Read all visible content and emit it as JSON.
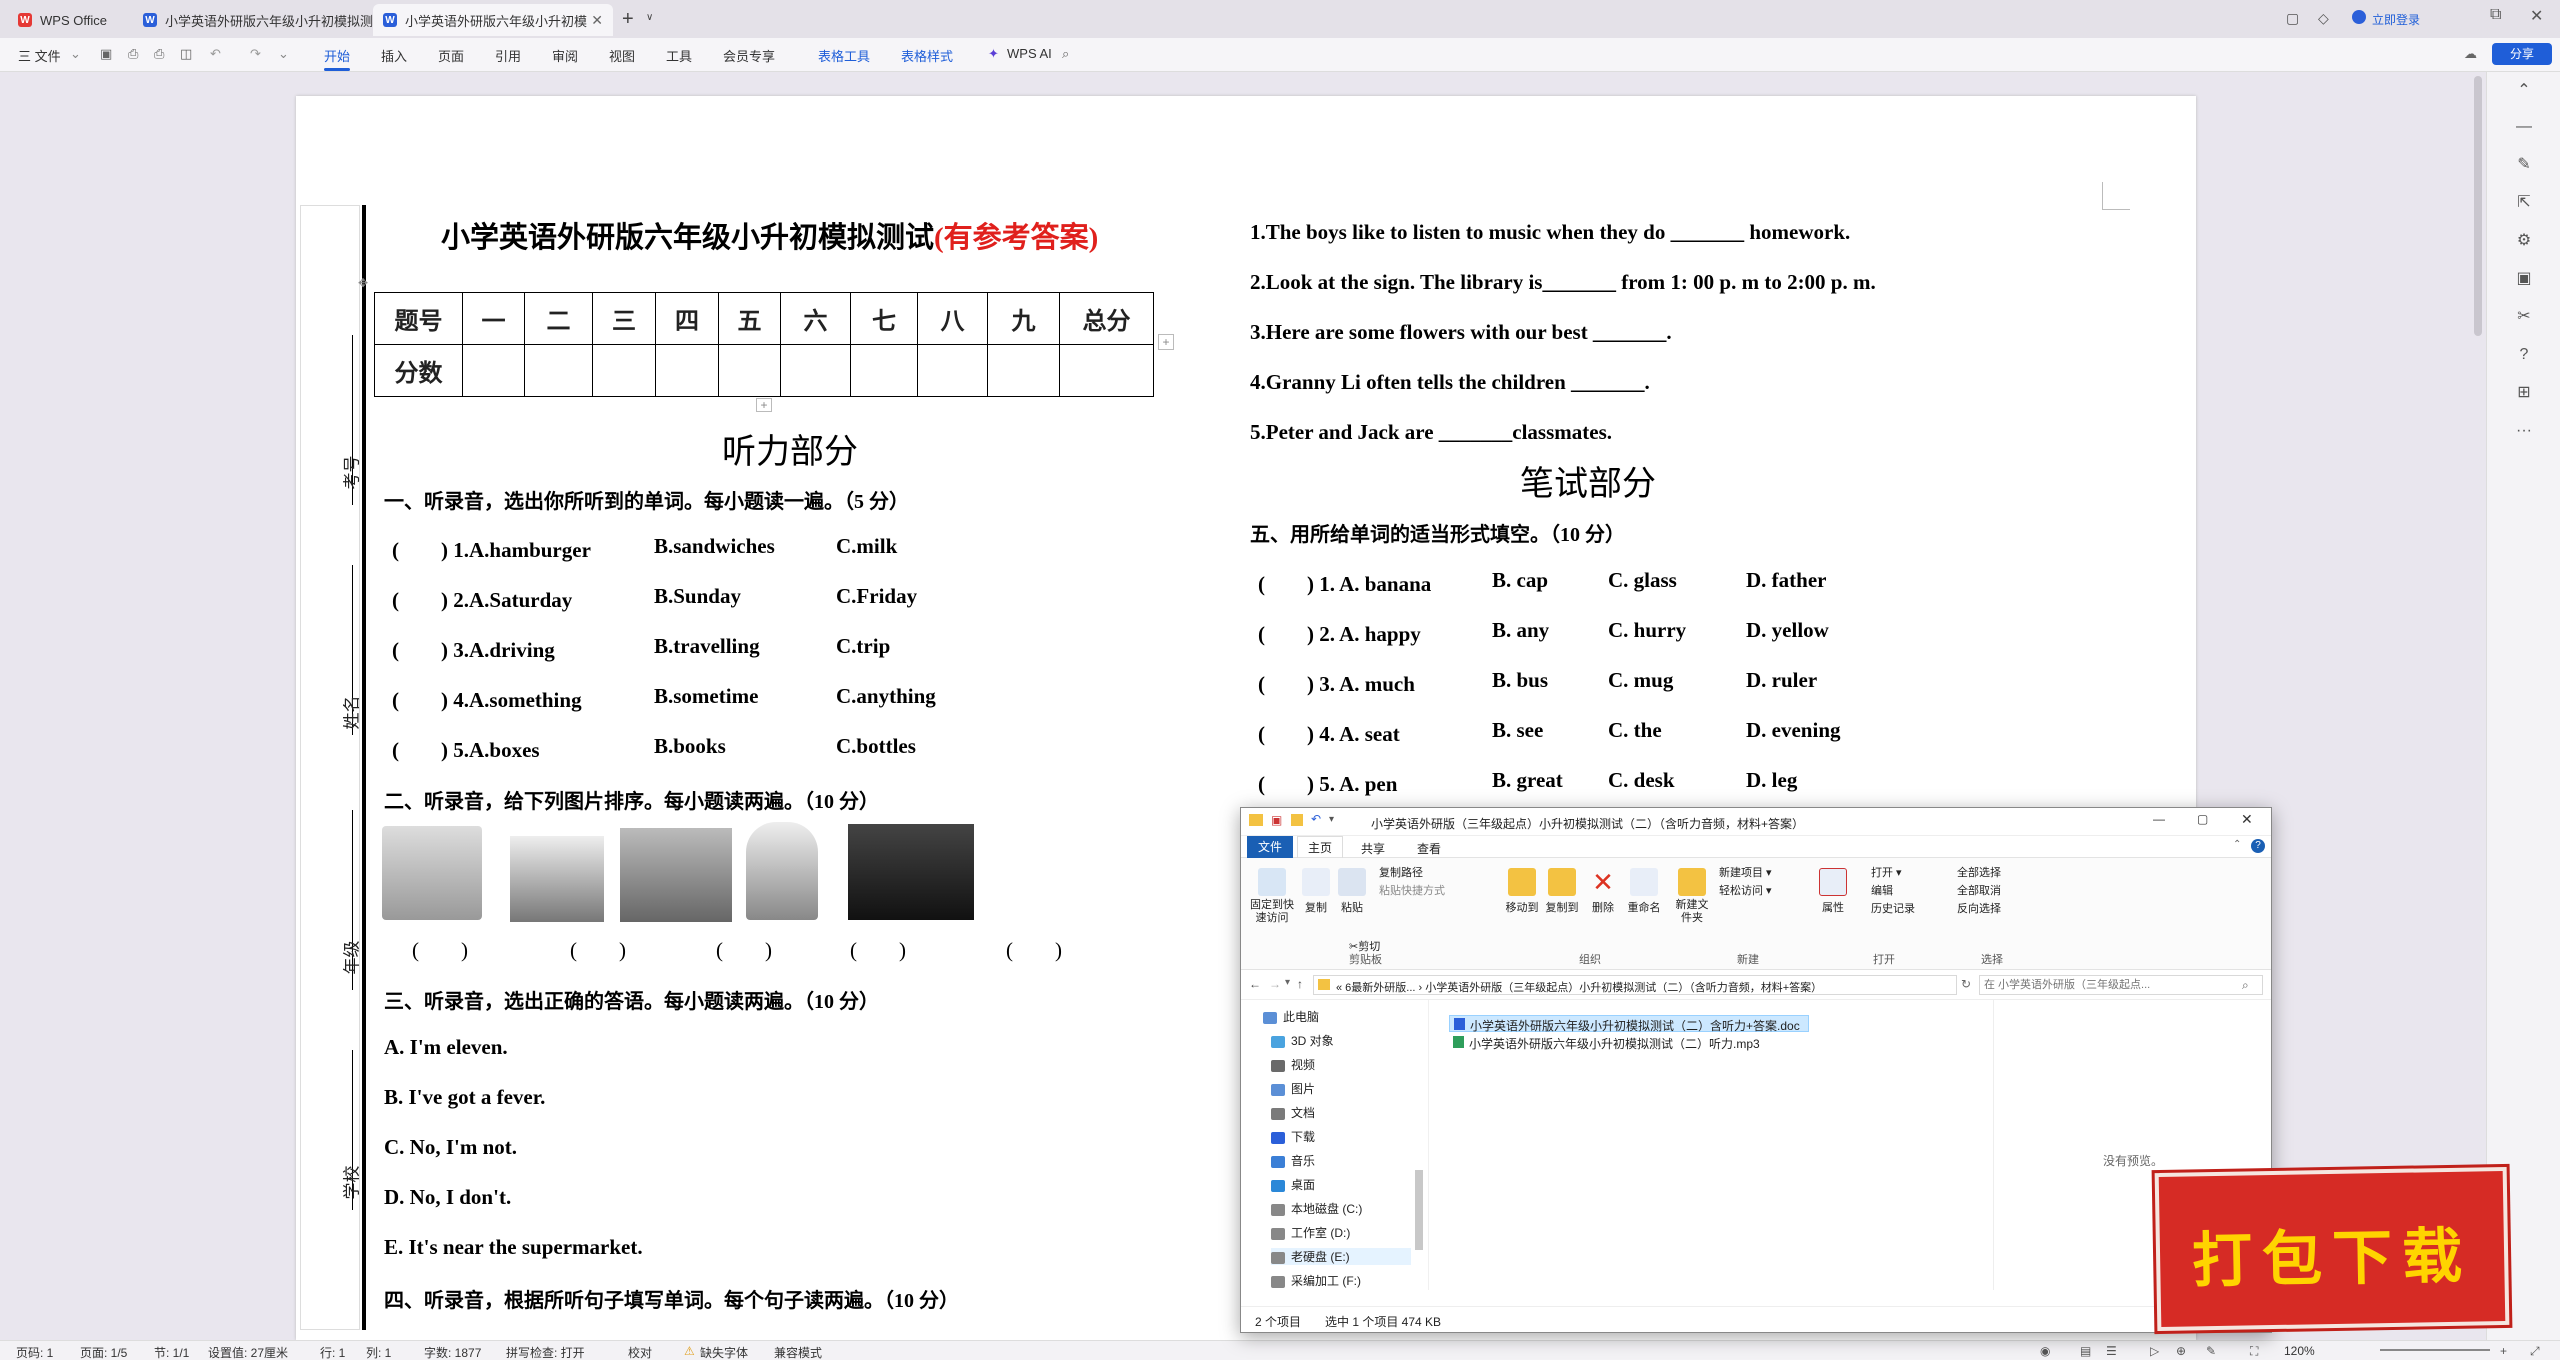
{
  "titlebar": {
    "tabs": [
      {
        "label": "WPS Office",
        "icon": "wps-logo-icon"
      },
      {
        "label": "小学英语外研版六年级小升初模拟测",
        "icon": "word-doc-icon"
      },
      {
        "label": "小学英语外研版六年级小升初模",
        "icon": "word-doc-icon"
      }
    ],
    "login": "立即登录"
  },
  "ribbon": {
    "file": "三 文件",
    "tabs": [
      "开始",
      "插入",
      "页面",
      "引用",
      "审阅",
      "视图",
      "工具",
      "会员专享"
    ],
    "context_tabs": [
      "表格工具",
      "表格样式"
    ],
    "ai": "WPS AI",
    "share": "分享"
  },
  "document": {
    "title": "小学英语外研版六年级小升初模拟测试",
    "title_note": "(有参考答案)",
    "binding_labels": [
      "考号",
      "姓名",
      "年级",
      "学校"
    ],
    "score_table": {
      "header": [
        "题号",
        "一",
        "二",
        "三",
        "四",
        "五",
        "六",
        "七",
        "八",
        "九",
        "总分"
      ],
      "row2_label": "分数"
    },
    "listening_heading": "听力部分",
    "sec1_title": "一、听录音，选出你所听到的单词。每小题读一遍。（5 分）",
    "sec1_items": [
      {
        "q": "(　　) 1.A.hamburger",
        "b": "B.sandwiches",
        "c": "C.milk"
      },
      {
        "q": "(　　) 2.A.Saturday",
        "b": "B.Sunday",
        "c": "C.Friday"
      },
      {
        "q": "(　　) 3.A.driving",
        "b": "B.travelling",
        "c": "C.trip"
      },
      {
        "q": "(　　) 4.A.something",
        "b": "B.sometime",
        "c": "C.anything"
      },
      {
        "q": "(　　) 5.A.boxes",
        "b": "B.books",
        "c": "C.bottles"
      }
    ],
    "sec2_title": "二、听录音，给下列图片排序。每小题读两遍。（10 分）",
    "sec2_brackets": [
      "(　　)",
      "(　　)",
      "(　　)",
      "(　　)",
      "(　　)"
    ],
    "sec3_title": "三、听录音，选出正确的答语。每小题读两遍。（10 分）",
    "sec3_items": [
      "A.  I'm eleven.",
      "B.  I've got a fever.",
      "C.  No, I'm not.",
      "D.  No, I don't.",
      "E.  It's near the supermarket."
    ],
    "sec4_title": "四、听录音，根据所听句子填写单词。每个句子读两遍。（10 分）",
    "sec4_items": [
      "1.The boys like to listen to music when they do _______ homework.",
      "2.Look at the sign. The library is_______    from 1: 00 p. m to 2:00 p. m.",
      "3.Here are some flowers with our best _______.",
      "4.Granny Li often tells the children _______.",
      "5.Peter and Jack are _______classmates."
    ],
    "writing_heading": "笔试部分",
    "sec5_title": "五、用所给单词的适当形式填空。（10 分）",
    "sec5_items": [
      {
        "q": "(　　) 1. A. banana",
        "b": "B. cap",
        "c": "C. glass",
        "d": "D. father"
      },
      {
        "q": "(　　) 2. A. happy",
        "b": "B. any",
        "c": "C. hurry",
        "d": "D. yellow"
      },
      {
        "q": "(　　) 3. A. much",
        "b": "B. bus",
        "c": "C. mug",
        "d": "D. ruler"
      },
      {
        "q": "(　　) 4. A. seat",
        "b": "B. see",
        "c": "C. the",
        "d": "D. evening"
      },
      {
        "q": "(　　) 5. A. pen",
        "b": "B. great",
        "c": "C. desk",
        "d": "D. leg"
      }
    ]
  },
  "status": {
    "page": "页码: 1",
    "pages": "页面: 1/5",
    "section": "节: 1/1",
    "setting": "设置值: 27厘米",
    "row": "行: 1",
    "col": "列: 1",
    "words": "字数: 1877",
    "spell": "拼写检查: 打开",
    "proof": "校对",
    "font_missing": "缺失字体",
    "compat": "兼容模式",
    "zoom": "120%"
  },
  "explorer": {
    "title": "小学英语外研版（三年级起点）小升初模拟测试（二）（含听力音频，材料+答案）",
    "menu": [
      "文件",
      "主页",
      "共享",
      "查看"
    ],
    "ribbon": {
      "pin": "固定到快速访问",
      "copy": "复制",
      "paste": "粘贴",
      "copy_path": "复制路径",
      "paste_shortcut": "粘贴快捷方式",
      "cut": "剪切",
      "move_to": "移动到",
      "copy_to": "复制到",
      "delete": "删除",
      "rename": "重命名",
      "new_folder": "新建文件夹",
      "new_item": "新建项目",
      "easy_access": "轻松访问",
      "properties": "属性",
      "open": "打开",
      "edit": "编辑",
      "history": "历史记录",
      "select_all": "全部选择",
      "select_none": "全部取消",
      "invert": "反向选择",
      "groups": [
        "剪贴板",
        "组织",
        "新建",
        "打开",
        "选择"
      ]
    },
    "address": "«  6最新外研版...  ›  小学英语外研版（三年级起点）小升初模拟测试（二）（含听力音频，材料+答案）",
    "search_placeholder": "在 小学英语外研版（三年级起点...",
    "nav": [
      "此电脑",
      "3D 对象",
      "视频",
      "图片",
      "文档",
      "下载",
      "音乐",
      "桌面",
      "本地磁盘 (C:)",
      "工作室 (D:)",
      "老硬盘 (E:)",
      "采编加工 (F:)"
    ],
    "files": [
      "小学英语外研版六年级小升初模拟测试（二）含听力+答案.doc",
      "小学英语外研版六年级小升初模拟测试（二）听力.mp3"
    ],
    "no_preview": "没有预览。",
    "status_count": "2 个项目",
    "status_selected": "选中 1 个项目  474 KB"
  },
  "download_badge": "打包下载",
  "colors": {
    "accent": "#1f5ed8",
    "red_note": "#e0201c",
    "badge_red": "#d62b25",
    "badge_text": "#ffd400"
  }
}
